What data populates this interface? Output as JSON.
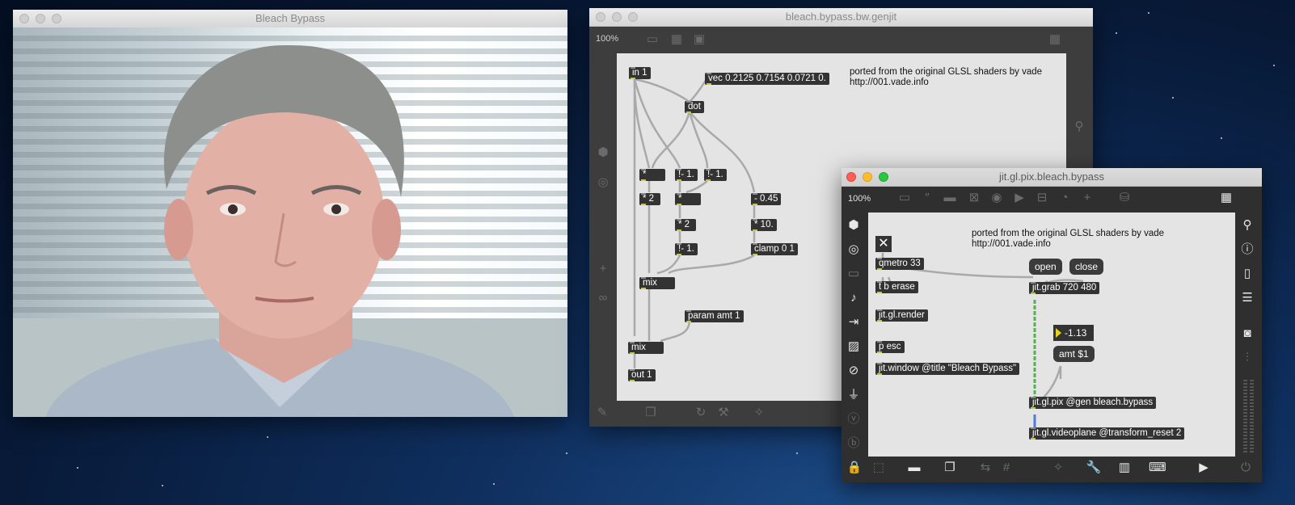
{
  "video_window": {
    "title": "Bleach Bypass"
  },
  "genjit_window": {
    "title": "bleach.bypass.bw.genjit",
    "zoom": "100%",
    "comment_line1": "ported from the original GLSL shaders by vade",
    "comment_line2": "http://001.vade.info",
    "objects": {
      "in1": "in 1",
      "vec": "vec 0.2125 0.7154 0.0721 0.",
      "dot": "dot",
      "mul_a": "*",
      "not_a": "!- 1.",
      "not_b": "!- 1.",
      "mul2_a": "* 2",
      "mul_b": "*",
      "sub": "- 0.45",
      "mul2_b": "* 2",
      "mul10": "* 10.",
      "not_c": "!- 1.",
      "clamp": "clamp 0 1",
      "mix_a": "mix",
      "param": "param amt 1",
      "mix_b": "mix",
      "out1": "out 1"
    }
  },
  "pix_window": {
    "title": "jit.gl.pix.bleach.bypass",
    "zoom": "100%",
    "comment_line1": "ported from the original GLSL shaders by vade",
    "comment_line2": "http://001.vade.info",
    "objects": {
      "qmetro": "qmetro 33",
      "tb": "t b erase",
      "render": "jit.gl.render",
      "pesc": "p esc",
      "window": "jit.window @title \"Bleach Bypass\"",
      "open": "open",
      "close": "close",
      "grab": "jit.grab 720 480",
      "number": "-1.13",
      "amt": "amt $1",
      "pix": "jit.gl.pix @gen bleach.bypass",
      "videoplane": "jit.gl.videoplane @transform_reset 2"
    }
  },
  "colors": {
    "accent_yellow": "#e6d21e",
    "patch_cord_green": "#4fb548",
    "desktop": "#0b2247"
  }
}
